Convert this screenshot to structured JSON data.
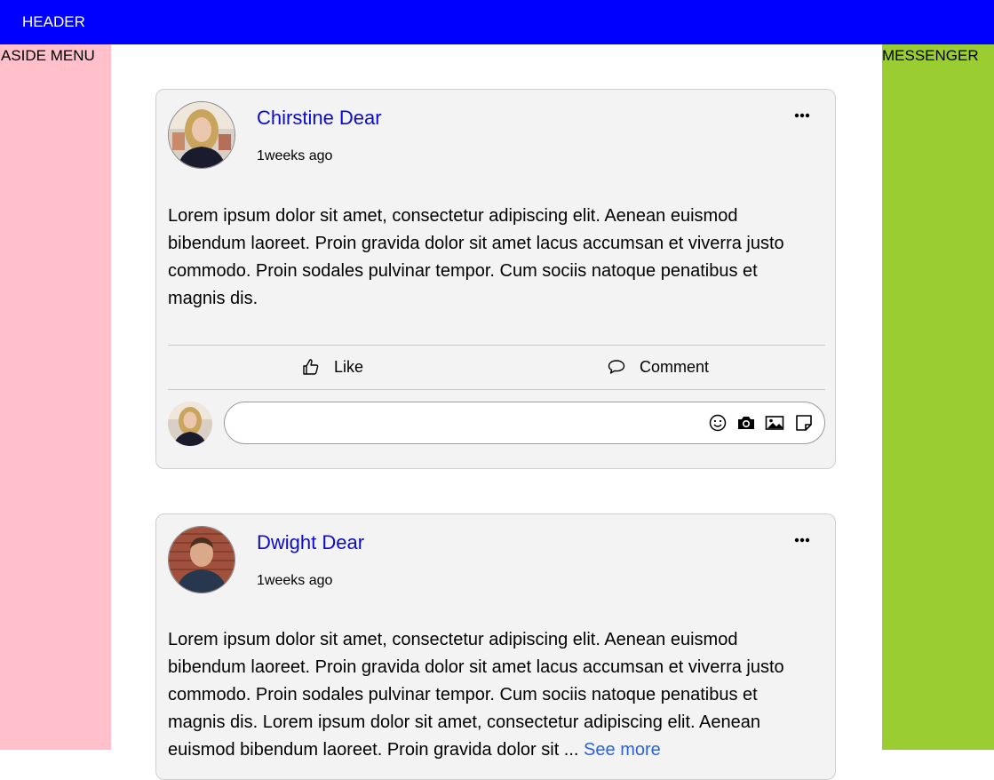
{
  "header": {
    "title": "HEADER"
  },
  "aside": {
    "label": "ASIDE MENU"
  },
  "messenger": {
    "label": "MESSENGER"
  },
  "posts": [
    {
      "author": "Chirstine Dear",
      "time": "1weeks ago",
      "text": "Lorem ipsum dolor sit amet, consectetur adipiscing elit. Aenean euismod bibendum laoreet. Proin gravida dolor sit amet lacus accumsan et viverra justo commodo. Proin sodales pulvinar tempor. Cum sociis natoque penatibus et magnis dis.",
      "like_label": "Like",
      "comment_label": "Comment",
      "comment_placeholder": ""
    },
    {
      "author": "Dwight Dear",
      "time": "1weeks ago",
      "text": "Lorem ipsum dolor sit amet, consectetur adipiscing elit. Aenean euismod bibendum laoreet. Proin gravida dolor sit amet lacus accumsan et viverra justo commodo. Proin sodales pulvinar tempor. Cum sociis natoque penatibus et magnis dis. Lorem ipsum dolor sit amet, consectetur adipiscing elit. Aenean euismod bibendum laoreet. Proin gravida dolor sit ...",
      "see_more": "See more"
    }
  ],
  "icons": {
    "more": "more-horizontal-icon",
    "like": "thumbs-up-icon",
    "comment": "speech-bubble-icon",
    "emoji": "smiley-icon",
    "camera": "camera-icon",
    "photo": "image-icon",
    "sticker": "sticker-icon"
  },
  "colors": {
    "header": "#0000ff",
    "aside": "#ffc0cb",
    "messenger": "#9acd32",
    "author": "#0b0bd0",
    "see_more": "#2e62d9",
    "card": "#f3f3f3"
  }
}
